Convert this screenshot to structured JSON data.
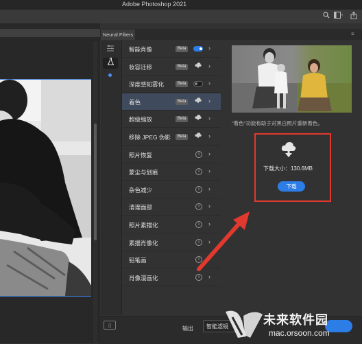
{
  "app": {
    "title": "Adobe Photoshop 2021"
  },
  "optionbar": {
    "icons": [
      "search-icon",
      "workspace-icon",
      "share-icon"
    ]
  },
  "panel": {
    "tab_label": "Neural Filters",
    "menu_glyph": "≡"
  },
  "sidebar": {
    "icons": [
      "filters-list-icon",
      "beaker-icon"
    ]
  },
  "filters": [
    {
      "name": "智能肖像",
      "badge": "Beta",
      "control": "toggle-on"
    },
    {
      "name": "妆容迁移",
      "badge": "Beta",
      "control": "cloud"
    },
    {
      "name": "深度感知雾化",
      "badge": "Beta",
      "control": "toggle-off"
    },
    {
      "name": "着色",
      "badge": "Beta",
      "control": "cloud",
      "selected": true
    },
    {
      "name": "超级缩放",
      "badge": "Beta",
      "control": "cloud"
    },
    {
      "name": "移除 JPEG 伪影",
      "badge": "Beta",
      "control": "cloud"
    },
    {
      "name": "照片恢复",
      "badge": "",
      "control": "info"
    },
    {
      "name": "蒙尘与划痕",
      "badge": "",
      "control": "info"
    },
    {
      "name": "杂色减少",
      "badge": "",
      "control": "info"
    },
    {
      "name": "清理面部",
      "badge": "",
      "control": "info"
    },
    {
      "name": "照片素描化",
      "badge": "",
      "control": "info"
    },
    {
      "name": "素描肖像化",
      "badge": "",
      "control": "info"
    },
    {
      "name": "铅笔画",
      "badge": "",
      "control": "info"
    },
    {
      "name": "肖像漫画化",
      "badge": "",
      "control": "info"
    }
  ],
  "detail": {
    "caption": "\"着色\"功能有助于对黑白照片重新着色。",
    "download_size": "下载大小：130.6MB",
    "download_button": "下载"
  },
  "footer": {
    "output_label": "输出",
    "output_value": "智能滤镜"
  },
  "watermark": {
    "text": "未来软件园",
    "url": "mac.orsoon.com"
  },
  "colors": {
    "accent": "#2d7de6",
    "highlight": "#e2392f",
    "selected_row": "#3f4a5c"
  }
}
